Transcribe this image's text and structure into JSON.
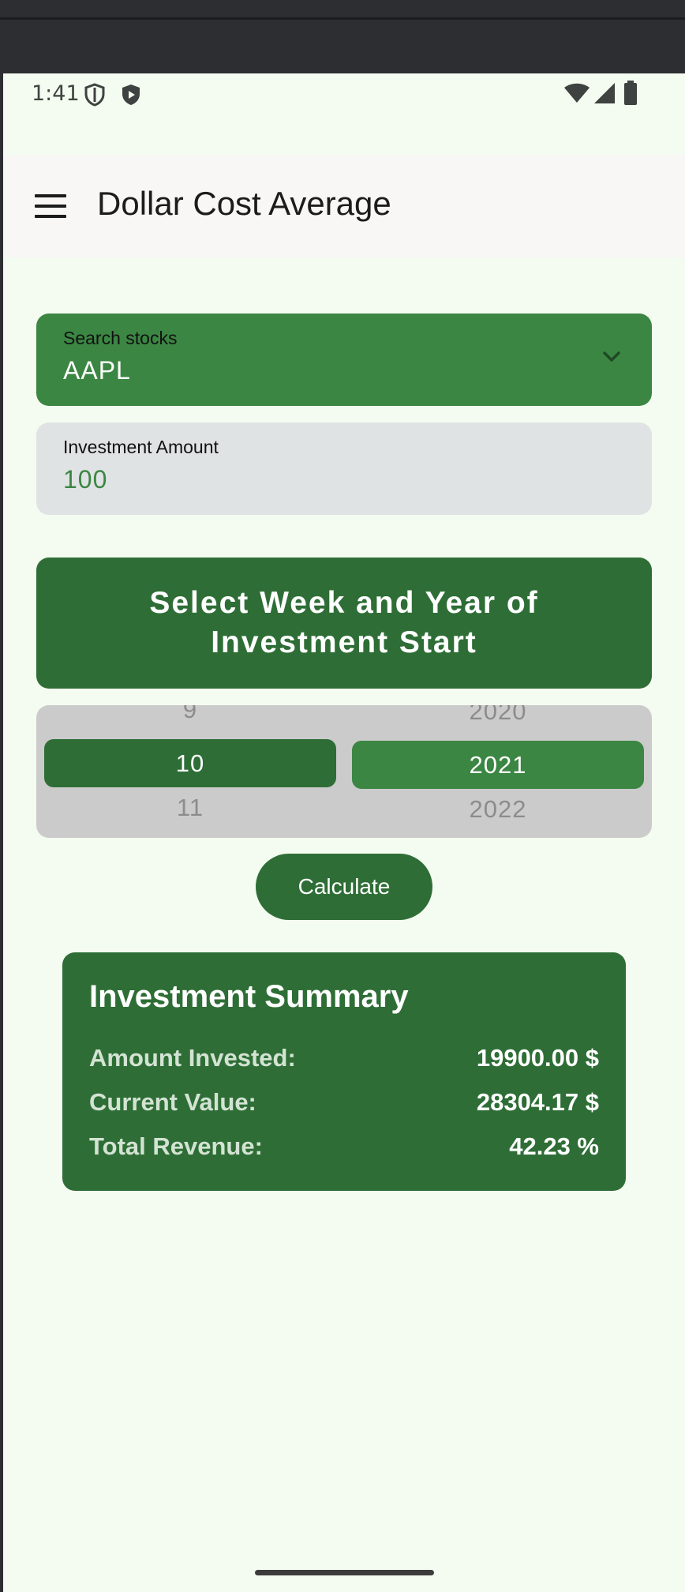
{
  "status_bar": {
    "time": "1:41",
    "icons": [
      "shield-outline-icon",
      "shield-play-icon",
      "wifi-icon",
      "signal-icon",
      "battery-icon"
    ]
  },
  "app_bar": {
    "title": "Dollar Cost Average",
    "menu_icon": "hamburger-menu-icon"
  },
  "search": {
    "label": "Search stocks",
    "value": "AAPL",
    "dropdown_icon": "chevron-down-icon"
  },
  "amount": {
    "label": "Investment Amount",
    "value": "100"
  },
  "week_banner": {
    "text": "Select Week and Year of Investment Start"
  },
  "picker": {
    "weeks": {
      "prev": "9",
      "selected": "10",
      "next": "11"
    },
    "years": {
      "prev": "2020",
      "selected": "2021",
      "next": "2022"
    }
  },
  "calculate_button": {
    "label": "Calculate"
  },
  "summary": {
    "title": "Investment Summary",
    "rows": [
      {
        "label": "Amount Invested:",
        "value": "19900.00 $"
      },
      {
        "label": "Current Value:",
        "value": "28304.17 $"
      },
      {
        "label": "Total Revenue:",
        "value": "42.23 %"
      }
    ]
  },
  "colors": {
    "primary_green": "#2e6e36",
    "search_green": "#3b8643",
    "background": "#f4fbf0",
    "picker_bg": "#cbcbcb",
    "field_bg": "#dfe3e3"
  }
}
